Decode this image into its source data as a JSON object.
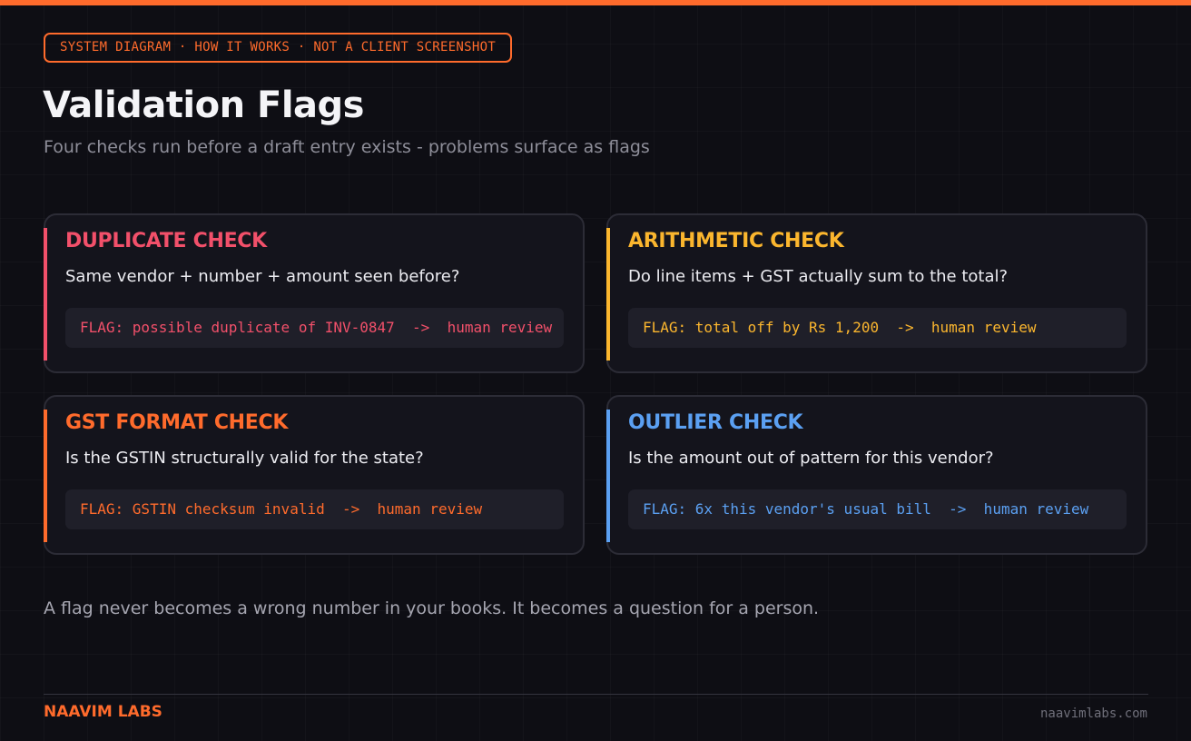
{
  "header": {
    "tag": "SYSTEM DIAGRAM · HOW IT WORKS · NOT A CLIENT SCREENSHOT",
    "title": "Validation Flags",
    "subtitle": "Four checks run before a draft entry exists - problems surface as flags"
  },
  "checks": [
    {
      "heading": "DUPLICATE CHECK",
      "question": "Same vendor + number + amount seen before?",
      "flag": "FLAG: possible duplicate of INV-0847  ->  human review",
      "color": "#f2506a"
    },
    {
      "heading": "ARITHMETIC CHECK",
      "question": "Do line items + GST actually sum to the total?",
      "flag": "FLAG: total off by Rs 1,200  ->  human review",
      "color": "#fbb62e"
    },
    {
      "heading": "GST FORMAT CHECK",
      "question": "Is the GSTIN structurally valid for the state?",
      "flag": "FLAG: GSTIN checksum invalid  ->  human review",
      "color": "#ff6b2c"
    },
    {
      "heading": "OUTLIER CHECK",
      "question": "Is the amount out of pattern for this vendor?",
      "flag": "FLAG: 6x this vendor's usual bill  ->  human review",
      "color": "#5ba0f2"
    }
  ],
  "tagline": "A flag never becomes a wrong number in your books. It becomes a question for a person.",
  "footer": {
    "brand": "NAAVIM LABS",
    "site": "naavimlabs.com"
  },
  "colors": {
    "accent": "#ff6b2c",
    "background": "#0e0e14",
    "card": "#14141c"
  }
}
